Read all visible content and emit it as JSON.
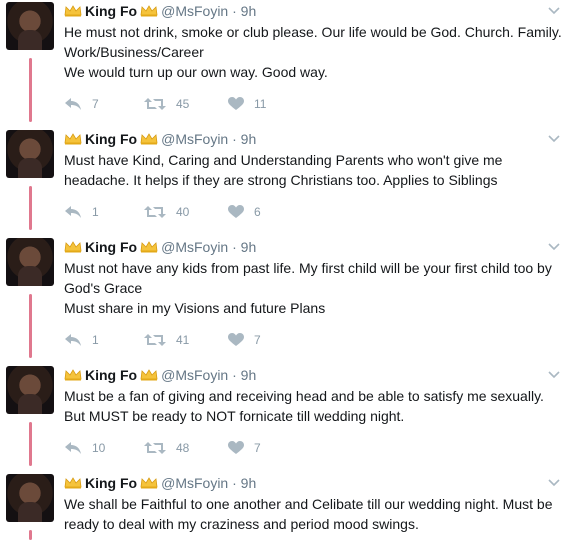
{
  "author": {
    "name": "King Fo",
    "handle": "@MsFoyin",
    "separator": "·"
  },
  "tweets": [
    {
      "time": "9h",
      "lines": [
        "He must not drink, smoke or club please. Our life would be God. Church. Family.",
        "Work/Business/Career",
        "We would turn up our own way. Good way."
      ],
      "replies": "7",
      "retweets": "45",
      "likes": "11"
    },
    {
      "time": "9h",
      "lines": [
        "Must have Kind, Caring and Understanding Parents who won't give me",
        "headache. It helps if they are strong Christians too. Applies to Siblings"
      ],
      "replies": "1",
      "retweets": "40",
      "likes": "6"
    },
    {
      "time": "9h",
      "lines": [
        "Must not have any kids from past life. My first child will be your first child too by",
        "God's Grace",
        "Must share in my Visions and future Plans"
      ],
      "replies": "1",
      "retweets": "41",
      "likes": "7"
    },
    {
      "time": "9h",
      "lines": [
        "Must be a fan of giving and receiving head and be able to satisfy me sexually.",
        "But MUST be ready to NOT fornicate till wedding night."
      ],
      "replies": "10",
      "retweets": "48",
      "likes": "7"
    },
    {
      "time": "9h",
      "lines": [
        "We shall be Faithful to one another and Celibate till our wedding night. Must be",
        "ready to deal with my craziness and period mood swings."
      ],
      "replies": "",
      "retweets": "",
      "likes": ""
    }
  ],
  "icons": {
    "crown": "crown-emoji-icon",
    "reply": "reply-icon",
    "retweet": "retweet-icon",
    "like": "heart-icon",
    "more": "chevron-down-icon"
  },
  "colors": {
    "thread_line": "#e0788e",
    "secondary_text": "#657786",
    "action_icon": "#8899a6",
    "crown": "#f5c33b"
  }
}
